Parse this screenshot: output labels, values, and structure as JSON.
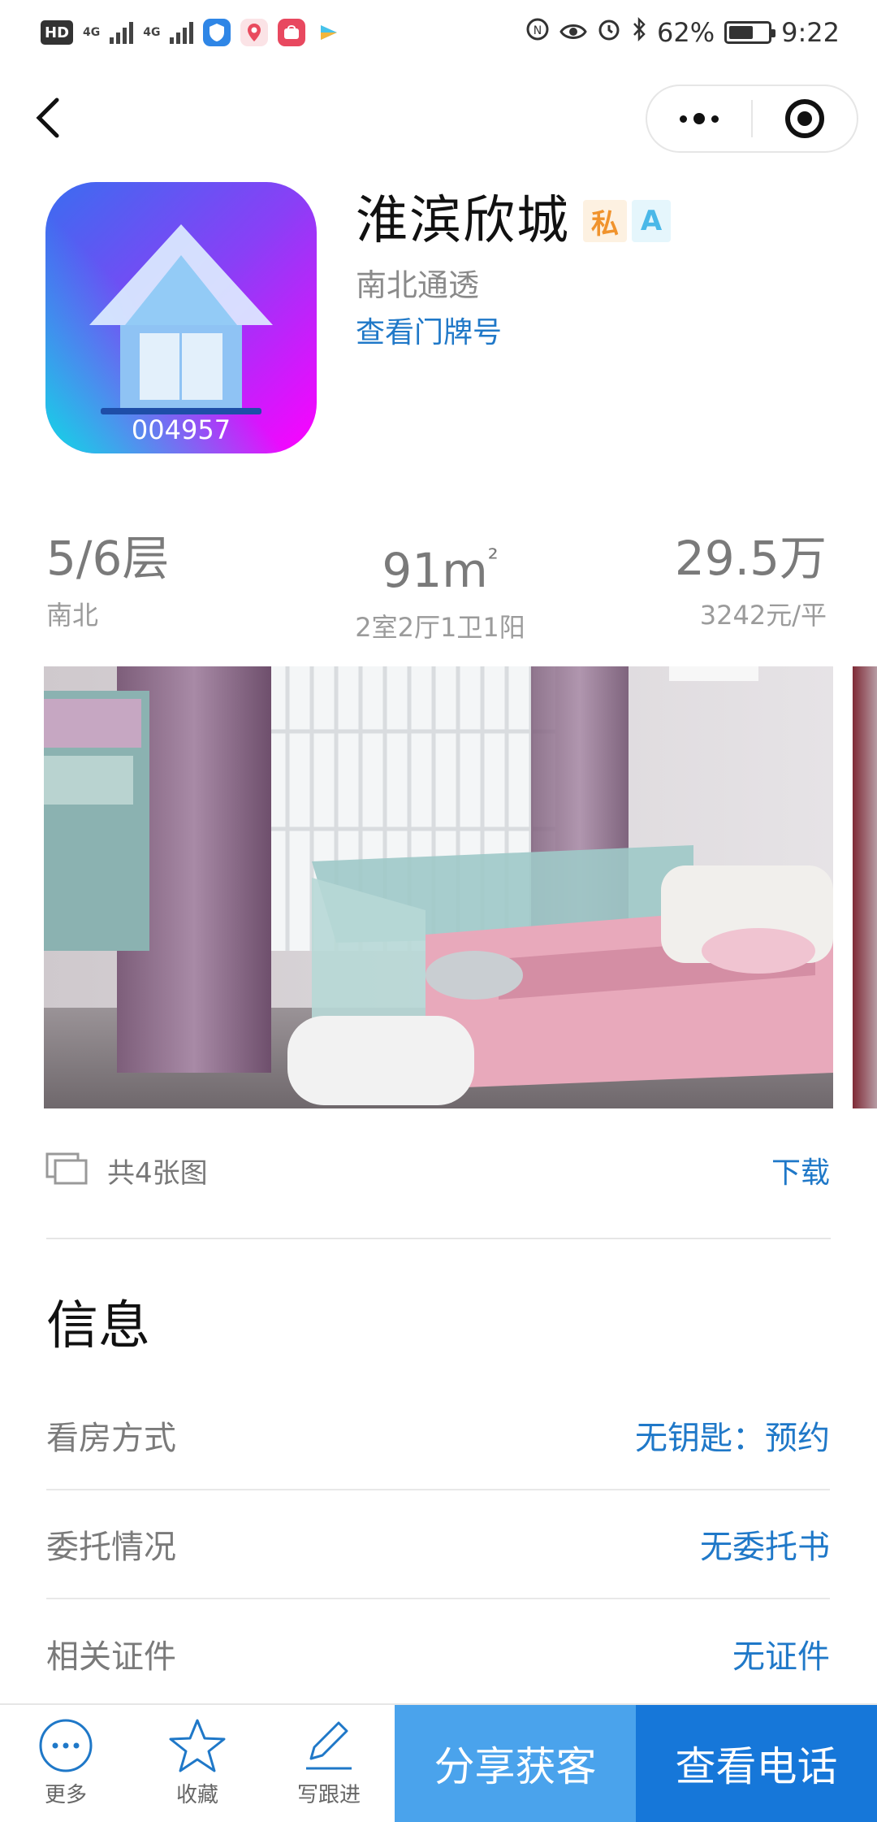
{
  "status_bar": {
    "hd": "HD",
    "network_1": "4G",
    "network_2": "4G",
    "nfc": "N",
    "battery_percent": "62%",
    "time": "9:22",
    "battery_level": 0.62
  },
  "listing": {
    "name": "淮滨欣城",
    "tag_private": "私",
    "tag_grade": "A",
    "orientation_feature": "南北通透",
    "doorplate_link": "查看门牌号",
    "code": "004957"
  },
  "stats": {
    "floor": "5/6层",
    "facing": "南北",
    "area": "91m",
    "area_unit_superscript": "²",
    "layout": "2室2厅1卫1阳",
    "price": "29.5万",
    "unit_price": "3242元/平"
  },
  "gallery": {
    "count_text": "共4张图",
    "download_label": "下载"
  },
  "info": {
    "section_title": "信息",
    "rows": [
      {
        "label": "看房方式",
        "value": "无钥匙：预约"
      },
      {
        "label": "委托情况",
        "value": "无委托书"
      },
      {
        "label": "相关证件",
        "value": "无证件"
      }
    ]
  },
  "bottom_bar": {
    "more": "更多",
    "favorite": "收藏",
    "follow_up": "写跟进",
    "share": "分享获客",
    "call": "查看电话"
  },
  "colors": {
    "link_blue": "#1f78c8",
    "share_button": "#4aa3ec",
    "call_button": "#1677d9"
  }
}
